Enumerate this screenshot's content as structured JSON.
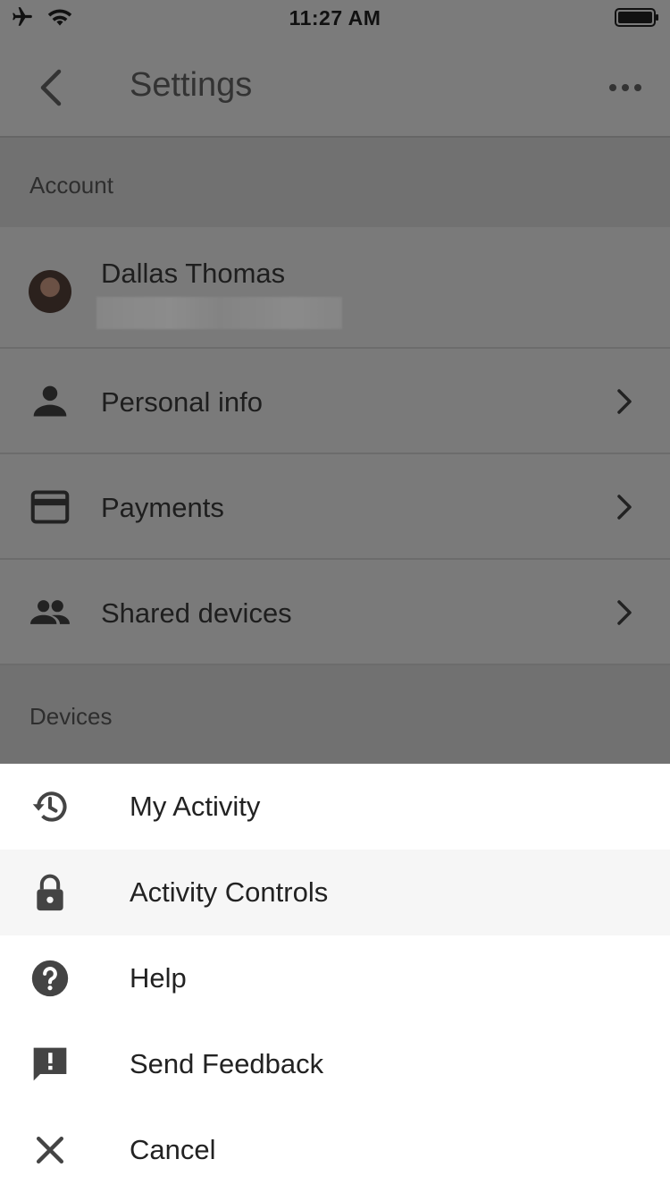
{
  "status_bar": {
    "time": "11:27 AM",
    "icons": [
      "airplane-mode-icon",
      "wifi-icon",
      "battery-icon"
    ]
  },
  "app_bar": {
    "title": "Settings",
    "icons": [
      "back-arrow-icon",
      "more-dots-icon"
    ]
  },
  "sections": {
    "account_header": "Account",
    "devices_header": "Devices"
  },
  "account": {
    "name": "Dallas Thomas"
  },
  "rows": [
    {
      "label": "Personal info",
      "icon": "person-icon"
    },
    {
      "label": "Payments",
      "icon": "credit-card-icon"
    },
    {
      "label": "Shared devices",
      "icon": "people-icon"
    }
  ],
  "sheet": {
    "items": [
      {
        "label": "My Activity",
        "icon": "history-icon"
      },
      {
        "label": "Activity Controls",
        "icon": "lock-icon"
      },
      {
        "label": "Help",
        "icon": "help-icon"
      },
      {
        "label": "Send Feedback",
        "icon": "feedback-icon"
      },
      {
        "label": "Cancel",
        "icon": "close-icon"
      }
    ]
  },
  "colors": {
    "overlay_background": "#7a7a7a",
    "sheet_background": "#ffffff",
    "highlight_row": "#f6f6f6"
  }
}
